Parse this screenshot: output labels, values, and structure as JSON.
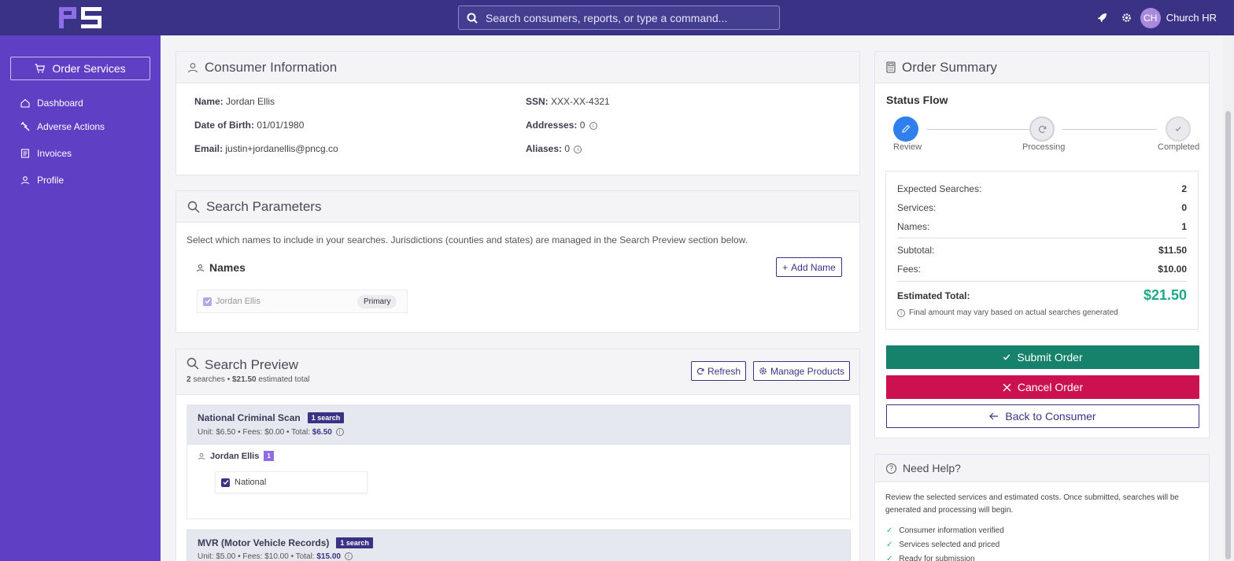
{
  "topbar": {
    "search_placeholder": "Search consumers, reports, or type a command...",
    "avatar_initials": "CH",
    "user_name": "Church HR"
  },
  "sidebar": {
    "order_button": "Order Services",
    "items": [
      {
        "label": "Dashboard",
        "icon": "home-icon"
      },
      {
        "label": "Adverse Actions",
        "icon": "gavel-icon"
      },
      {
        "label": "Invoices",
        "icon": "invoice-icon"
      },
      {
        "label": "Profile",
        "icon": "user-icon"
      }
    ]
  },
  "consumer": {
    "title": "Consumer Information",
    "name_label": "Name:",
    "name": "Jordan Ellis",
    "dob_label": "Date of Birth:",
    "dob": "01/01/1980",
    "email_label": "Email:",
    "email": "justin+jordanellis@pncg.co",
    "ssn_label": "SSN:",
    "ssn": "XXX-XX-4321",
    "addresses_label": "Addresses:",
    "addresses": "0",
    "aliases_label": "Aliases:",
    "aliases": "0"
  },
  "search_params": {
    "title": "Search Parameters",
    "description": "Select which names to include in your searches. Jurisdictions (counties and states) are managed in the Search Preview section below.",
    "names_title": "Names",
    "add_name": "Add Name",
    "name_entry": "Jordan Ellis",
    "name_badge": "Primary"
  },
  "preview": {
    "title": "Search Preview",
    "searches_count": "2",
    "searches_word": "searches •",
    "estimated_total": "$21.50",
    "estimated_word": "estimated total",
    "refresh": "Refresh",
    "manage": "Manage Products",
    "products": [
      {
        "name": "National Criminal Scan",
        "badge": "1 search",
        "pricing": "Unit: $6.50 • Fees: $0.00 • Total:",
        "total": "$6.50",
        "person": "Jordan Ellis",
        "person_count": "1",
        "jurisdiction": "National"
      },
      {
        "name": "MVR (Motor Vehicle Records)",
        "badge": "1 search",
        "pricing": "Unit: $5.00 • Fees: $10.00 • Total:",
        "total": "$15.00"
      }
    ]
  },
  "summary": {
    "title": "Order Summary",
    "status_flow": "Status Flow",
    "steps": [
      "Review",
      "Processing",
      "Completed"
    ],
    "expected_label": "Expected Searches:",
    "expected": "2",
    "services_label": "Services:",
    "services": "0",
    "names_label": "Names:",
    "names": "1",
    "subtotal_label": "Subtotal:",
    "subtotal": "$11.50",
    "fees_label": "Fees:",
    "fees": "$10.00",
    "total_label": "Estimated Total:",
    "total": "$21.50",
    "note": "Final amount may vary based on actual searches generated",
    "submit": "Submit Order",
    "cancel": "Cancel Order",
    "back": "Back to Consumer"
  },
  "help": {
    "title": "Need Help?",
    "text": "Review the selected services and estimated costs. Once submitted, searches will be generated and processing will begin.",
    "checks": [
      "Consumer information verified",
      "Services selected and priced",
      "Ready for submission"
    ]
  },
  "colors": {
    "topbar": "#3a3385",
    "sidebar": "#5f3fc4",
    "submit": "#16826c",
    "cancel": "#cc1150",
    "total": "#1fa98a",
    "step_active": "#2f80ed"
  }
}
